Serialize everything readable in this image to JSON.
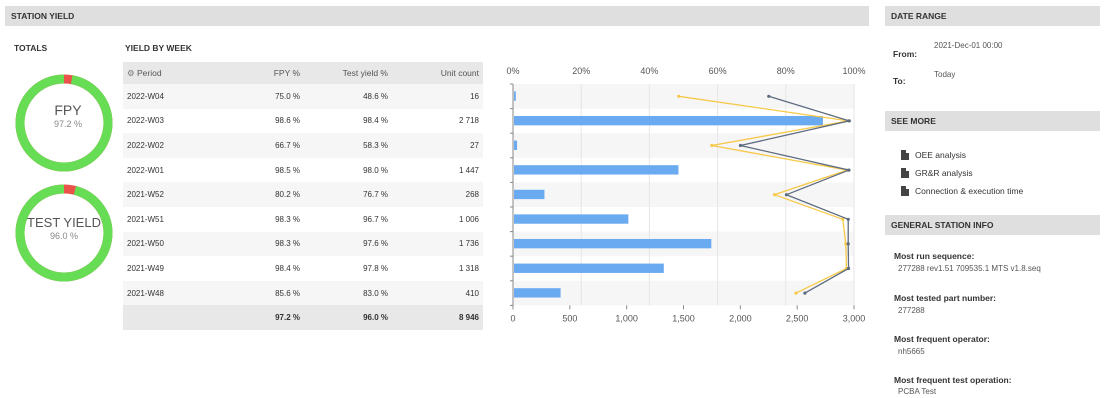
{
  "station_yield": {
    "header": "STATION YIELD",
    "totals_label": "TOTALS",
    "fpy_title": "FPY",
    "fpy_value": "97.2 %",
    "fpy_fraction": 0.972,
    "test_yield_title": "TEST YIELD",
    "test_yield_value": "96.0 %",
    "test_yield_fraction": 0.96,
    "yield_by_week_label": "YIELD BY WEEK",
    "columns": {
      "period": "Period",
      "fpy": "FPY %",
      "test_yield": "Test yield %",
      "unit_count": "Unit count"
    },
    "rows": [
      {
        "period": "2022-W04",
        "fpy": "75.0 %",
        "fpy_status": "red",
        "test_yield": "48.6 %",
        "ty_status": "red",
        "unit_count": "16"
      },
      {
        "period": "2022-W03",
        "fpy": "98.6 %",
        "fpy_status": "green",
        "test_yield": "98.4 %",
        "ty_status": "green",
        "unit_count": "2 718"
      },
      {
        "period": "2022-W02",
        "fpy": "66.7 %",
        "fpy_status": "red",
        "test_yield": "58.3 %",
        "ty_status": "red",
        "unit_count": "27"
      },
      {
        "period": "2022-W01",
        "fpy": "98.5 %",
        "fpy_status": "green",
        "test_yield": "98.0 %",
        "ty_status": "green",
        "unit_count": "1 447"
      },
      {
        "period": "2021-W52",
        "fpy": "80.2 %",
        "fpy_status": "orange",
        "test_yield": "76.7 %",
        "ty_status": "orange",
        "unit_count": "268"
      },
      {
        "period": "2021-W51",
        "fpy": "98.3 %",
        "fpy_status": "green",
        "test_yield": "96.7 %",
        "ty_status": "green",
        "unit_count": "1 006"
      },
      {
        "period": "2021-W50",
        "fpy": "98.3 %",
        "fpy_status": "green",
        "test_yield": "97.6 %",
        "ty_status": "green",
        "unit_count": "1 736"
      },
      {
        "period": "2021-W49",
        "fpy": "98.4 %",
        "fpy_status": "green",
        "test_yield": "97.8 %",
        "ty_status": "green",
        "unit_count": "1 318"
      },
      {
        "period": "2021-W48",
        "fpy": "85.6 %",
        "fpy_status": "orange",
        "test_yield": "83.0 %",
        "ty_status": "orange",
        "unit_count": "410"
      }
    ],
    "totals": {
      "fpy": "97.2 %",
      "test_yield": "96.0 %",
      "unit_count": "8 946"
    }
  },
  "colors": {
    "green": "#66dd55",
    "red": "#e9534a",
    "bar_blue": "#6aaaf0",
    "fpy_line": "#5d6b80",
    "test_yield_line": "#f7c948"
  },
  "chart_data": {
    "type": "bar",
    "categories": [
      "2022-W04",
      "2022-W03",
      "2022-W02",
      "2022-W01",
      "2021-W52",
      "2021-W51",
      "2021-W50",
      "2021-W49",
      "2021-W48"
    ],
    "series": [
      {
        "values": [
          16,
          2718,
          27,
          1447,
          268,
          1006,
          1736,
          1318,
          410
        ]
      },
      {
        "values": [
          75.0,
          98.6,
          66.7,
          98.5,
          80.2,
          98.3,
          98.3,
          98.4,
          85.6
        ]
      },
      {
        "values": [
          48.6,
          98.4,
          58.3,
          98.0,
          76.7,
          96.7,
          97.6,
          97.8,
          83.0
        ]
      }
    ],
    "top_axis": {
      "range": [
        0,
        100
      ],
      "ticks": [
        "0%",
        "20%",
        "40%",
        "60%",
        "80%",
        "100%"
      ]
    },
    "bottom_axis": {
      "range": [
        0,
        3000
      ],
      "ticks": [
        "0",
        "500",
        "1,000",
        "1,500",
        "2,000",
        "2,500",
        "3,000"
      ]
    }
  },
  "date_range": {
    "header": "DATE RANGE",
    "from_label": "From:",
    "from_value": "2021-Dec-01 00:00",
    "to_label": "To:",
    "to_value": "Today"
  },
  "see_more": {
    "header": "SEE MORE",
    "links": [
      {
        "label": "OEE analysis",
        "icon": "document-icon"
      },
      {
        "label": "GR&R analysis",
        "icon": "document-icon"
      },
      {
        "label": "Connection & execution time",
        "icon": "document-icon"
      }
    ]
  },
  "station_info": {
    "header": "GENERAL STATION INFO",
    "items": [
      {
        "label": "Most run sequence:",
        "value": "277288 rev1.51 709535.1 MTS v1.8.seq"
      },
      {
        "label": "Most tested part number:",
        "value": "277288"
      },
      {
        "label": "Most frequent operator:",
        "value": "nh5665"
      },
      {
        "label": "Most frequent test operation:",
        "value": "PCBA Test"
      }
    ]
  }
}
